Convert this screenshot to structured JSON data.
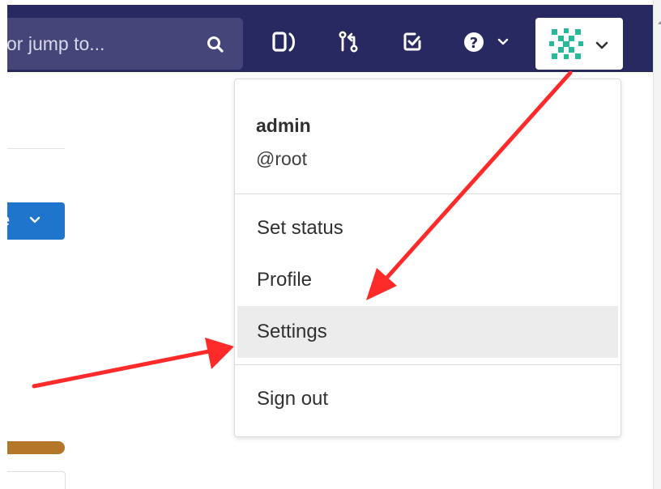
{
  "header": {
    "search": {
      "value": "or jump to..."
    },
    "icons": [
      {
        "name": "issues-icon"
      },
      {
        "name": "merge-request-icon"
      },
      {
        "name": "todos-icon"
      },
      {
        "name": "help-icon"
      }
    ],
    "avatar": {
      "name": "avatar-icon",
      "color": "#26b99a"
    }
  },
  "background": {
    "button_text": "e"
  },
  "user_menu": {
    "name": "admin",
    "handle": "@root",
    "items": [
      {
        "label": "Set status"
      },
      {
        "label": "Profile"
      },
      {
        "label": "Settings",
        "highlighted": true
      },
      {
        "label": "Sign out"
      }
    ]
  },
  "colors": {
    "navbar": "#292961",
    "search_bg": "#45457a",
    "menu_hover": "#ececec",
    "annotation_arrow": "#ff2a2a",
    "background_button": "#1f75cb",
    "background_bar": "#b47628"
  }
}
